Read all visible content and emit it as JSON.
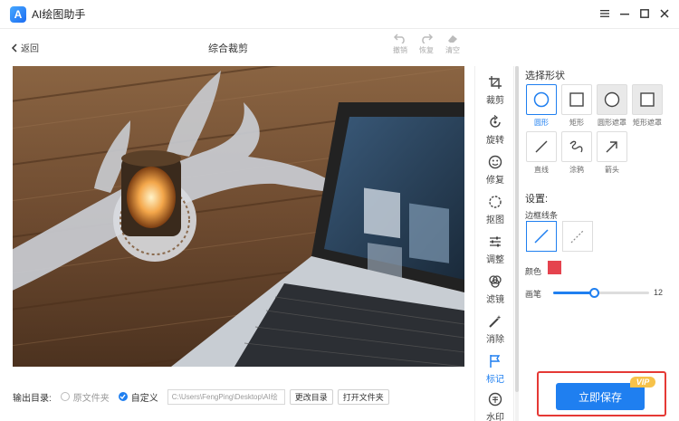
{
  "app": {
    "title": "AI绘图助手",
    "logo_text": "A"
  },
  "window_controls": [
    "menu-icon",
    "minimize-icon",
    "maximize-icon",
    "close-icon"
  ],
  "toolbar": {
    "back_label": "返回",
    "title": "综合裁剪",
    "undo_label": "撤销",
    "redo_label": "恢复",
    "clear_label": "清空"
  },
  "tools": [
    {
      "label": "裁剪",
      "icon": "crop-icon"
    },
    {
      "label": "旋转",
      "icon": "rotate-icon"
    },
    {
      "label": "修复",
      "icon": "face-icon"
    },
    {
      "label": "抠图",
      "icon": "cutout-icon"
    },
    {
      "label": "调整",
      "icon": "adjust-sliders-icon"
    },
    {
      "label": "滤镜",
      "icon": "filter-icon"
    },
    {
      "label": "消除",
      "icon": "magic-wand-icon"
    },
    {
      "label": "标记",
      "icon": "flag-icon",
      "active": true
    },
    {
      "label": "水印",
      "icon": "watermark-icon"
    }
  ],
  "panel": {
    "shape_title": "选择形状",
    "shapes": [
      {
        "label": "圆形",
        "icon": "circle-icon",
        "active": true
      },
      {
        "label": "矩形",
        "icon": "rectangle-icon"
      },
      {
        "label": "圆形遮罩",
        "icon": "circle-mask-icon"
      },
      {
        "label": "矩形遮罩",
        "icon": "rectangle-mask-icon"
      },
      {
        "label": "直线",
        "icon": "line-icon"
      },
      {
        "label": "涂鸦",
        "icon": "scribble-icon"
      },
      {
        "label": "箭头",
        "icon": "arrow-icon"
      }
    ],
    "settings_title": "设置:",
    "border_label": "边框线条",
    "color_label": "颜色",
    "color_value": "#e5434e",
    "brush_label": "画笔",
    "brush_value": "12",
    "brush_fraction": 0.42
  },
  "bottom": {
    "output_label": "输出目录:",
    "option_original": "原文件夹",
    "option_custom": "自定义",
    "path_value": "C:\\Users\\FengPing\\Desktop\\AI绘",
    "change_dir_label": "更改目录",
    "open_folder_label": "打开文件夹"
  },
  "save": {
    "label": "立即保存",
    "badge": "VIP"
  },
  "colors": {
    "accent": "#1f7ff0",
    "highlight_border": "#e53935",
    "vip": "#f7c24a"
  }
}
